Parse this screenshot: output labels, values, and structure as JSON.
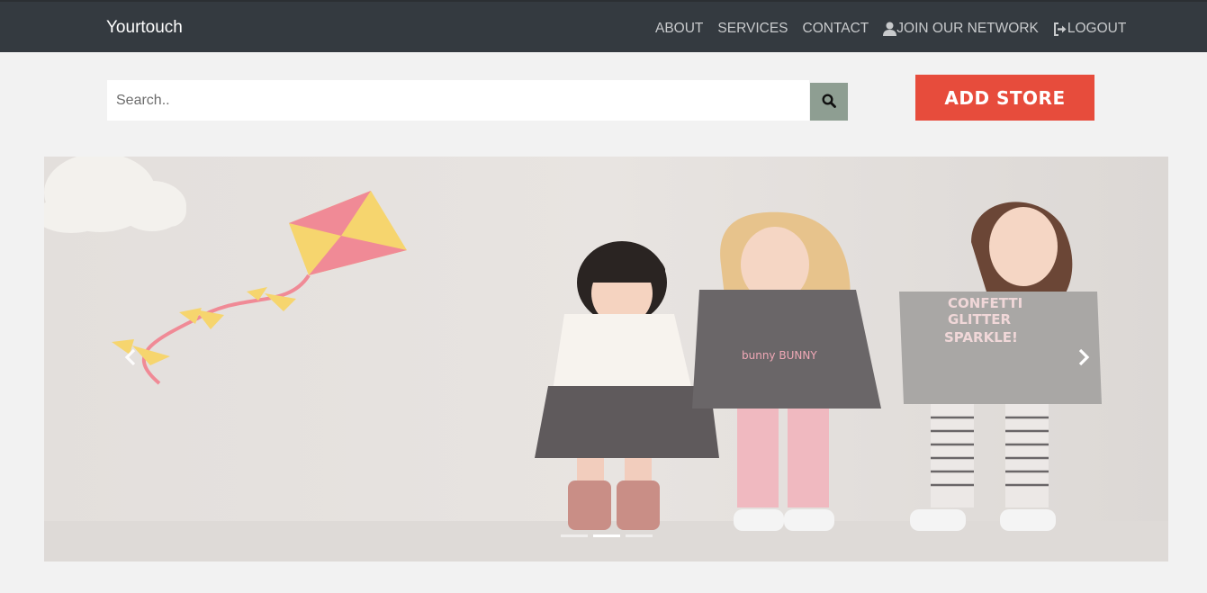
{
  "navbar": {
    "brand": "Yourtouch",
    "links": [
      {
        "label": "ABOUT",
        "icon": null
      },
      {
        "label": "SERVICES",
        "icon": null
      },
      {
        "label": "CONTACT",
        "icon": null
      },
      {
        "label": "JOIN OUR NETWORK",
        "icon": "user-icon"
      },
      {
        "label": "LOGOUT",
        "icon": "logout-icon"
      }
    ]
  },
  "search": {
    "placeholder": "Search..",
    "value": "",
    "button_icon": "search-icon"
  },
  "actions": {
    "add_store_label": "ADD STORE"
  },
  "carousel": {
    "slide_count": 3,
    "active_index": 1,
    "prev_icon": "chevron-left-icon",
    "next_icon": "chevron-right-icon",
    "slide_image": "three-girls-holding-hands-with-kite",
    "shirt_text": [
      "CONFETTI",
      "GLITTER",
      "SPARKLE!"
    ],
    "shirt_text_2": "bunny BUNNY"
  },
  "colors": {
    "navbar": "#343a40",
    "accent": "#e74c3c",
    "search_button": "#8e9e92",
    "page_bg": "#f2f2f2"
  }
}
